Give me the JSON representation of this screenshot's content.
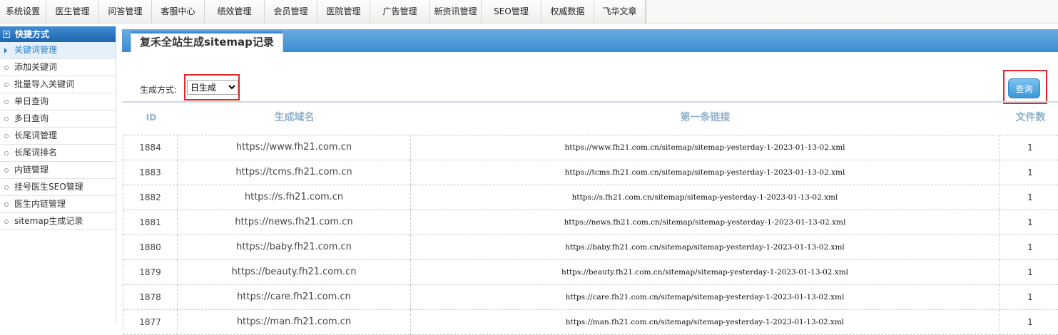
{
  "topnav": {
    "tabs": [
      "系统设置",
      "医生管理",
      "问答管理",
      "客服中心",
      "绩效管理",
      "会员管理",
      "医院管理",
      "广告管理",
      "新资讯管理",
      "SEO管理",
      "权威数据",
      "飞华文章"
    ]
  },
  "sidebar": {
    "title": "快捷方式",
    "items": [
      {
        "label": "关键词管理",
        "active": true
      },
      {
        "label": "添加关键词",
        "active": false
      },
      {
        "label": "批量导入关键词",
        "active": false
      },
      {
        "label": "单日查询",
        "active": false
      },
      {
        "label": "多日查询",
        "active": false
      },
      {
        "label": "长尾词管理",
        "active": false
      },
      {
        "label": "长尾词排名",
        "active": false
      },
      {
        "label": "内链管理",
        "active": false
      },
      {
        "label": "挂号医生SEO管理",
        "active": false
      },
      {
        "label": "医生内链管理",
        "active": false
      },
      {
        "label": "sitemap生成记录",
        "active": false
      }
    ]
  },
  "main": {
    "title": "复禾全站生成sitemap记录",
    "filter_label": "生成方式:",
    "mode_selected": "日生成",
    "query_label": "查询",
    "columns": {
      "id": "ID",
      "domain": "生成域名",
      "link": "第一条链接",
      "count": "文件数"
    },
    "rows": [
      {
        "id": "1884",
        "domain": "https://www.fh21.com.cn",
        "link": "https://www.fh21.com.cn/sitemap/sitemap-yesterday-1-2023-01-13-02.xml",
        "count": "1"
      },
      {
        "id": "1883",
        "domain": "https://tcms.fh21.com.cn",
        "link": "https://tcms.fh21.com.cn/sitemap/sitemap-yesterday-1-2023-01-13-02.xml",
        "count": "1"
      },
      {
        "id": "1882",
        "domain": "https://s.fh21.com.cn",
        "link": "https://s.fh21.com.cn/sitemap/sitemap-yesterday-1-2023-01-13-02.xml",
        "count": "1"
      },
      {
        "id": "1881",
        "domain": "https://news.fh21.com.cn",
        "link": "https://news.fh21.com.cn/sitemap/sitemap-yesterday-1-2023-01-13-02.xml",
        "count": "1"
      },
      {
        "id": "1880",
        "domain": "https://baby.fh21.com.cn",
        "link": "https://baby.fh21.com.cn/sitemap/sitemap-yesterday-1-2023-01-13-02.xml",
        "count": "1"
      },
      {
        "id": "1879",
        "domain": "https://beauty.fh21.com.cn",
        "link": "https://beauty.fh21.com.cn/sitemap/sitemap-yesterday-1-2023-01-13-02.xml",
        "count": "1"
      },
      {
        "id": "1878",
        "domain": "https://care.fh21.com.cn",
        "link": "https://care.fh21.com.cn/sitemap/sitemap-yesterday-1-2023-01-13-02.xml",
        "count": "1"
      },
      {
        "id": "1877",
        "domain": "https://man.fh21.com.cn",
        "link": "https://man.fh21.com.cn/sitemap/sitemap-yesterday-1-2023-01-13-02.xml",
        "count": "1"
      }
    ]
  }
}
